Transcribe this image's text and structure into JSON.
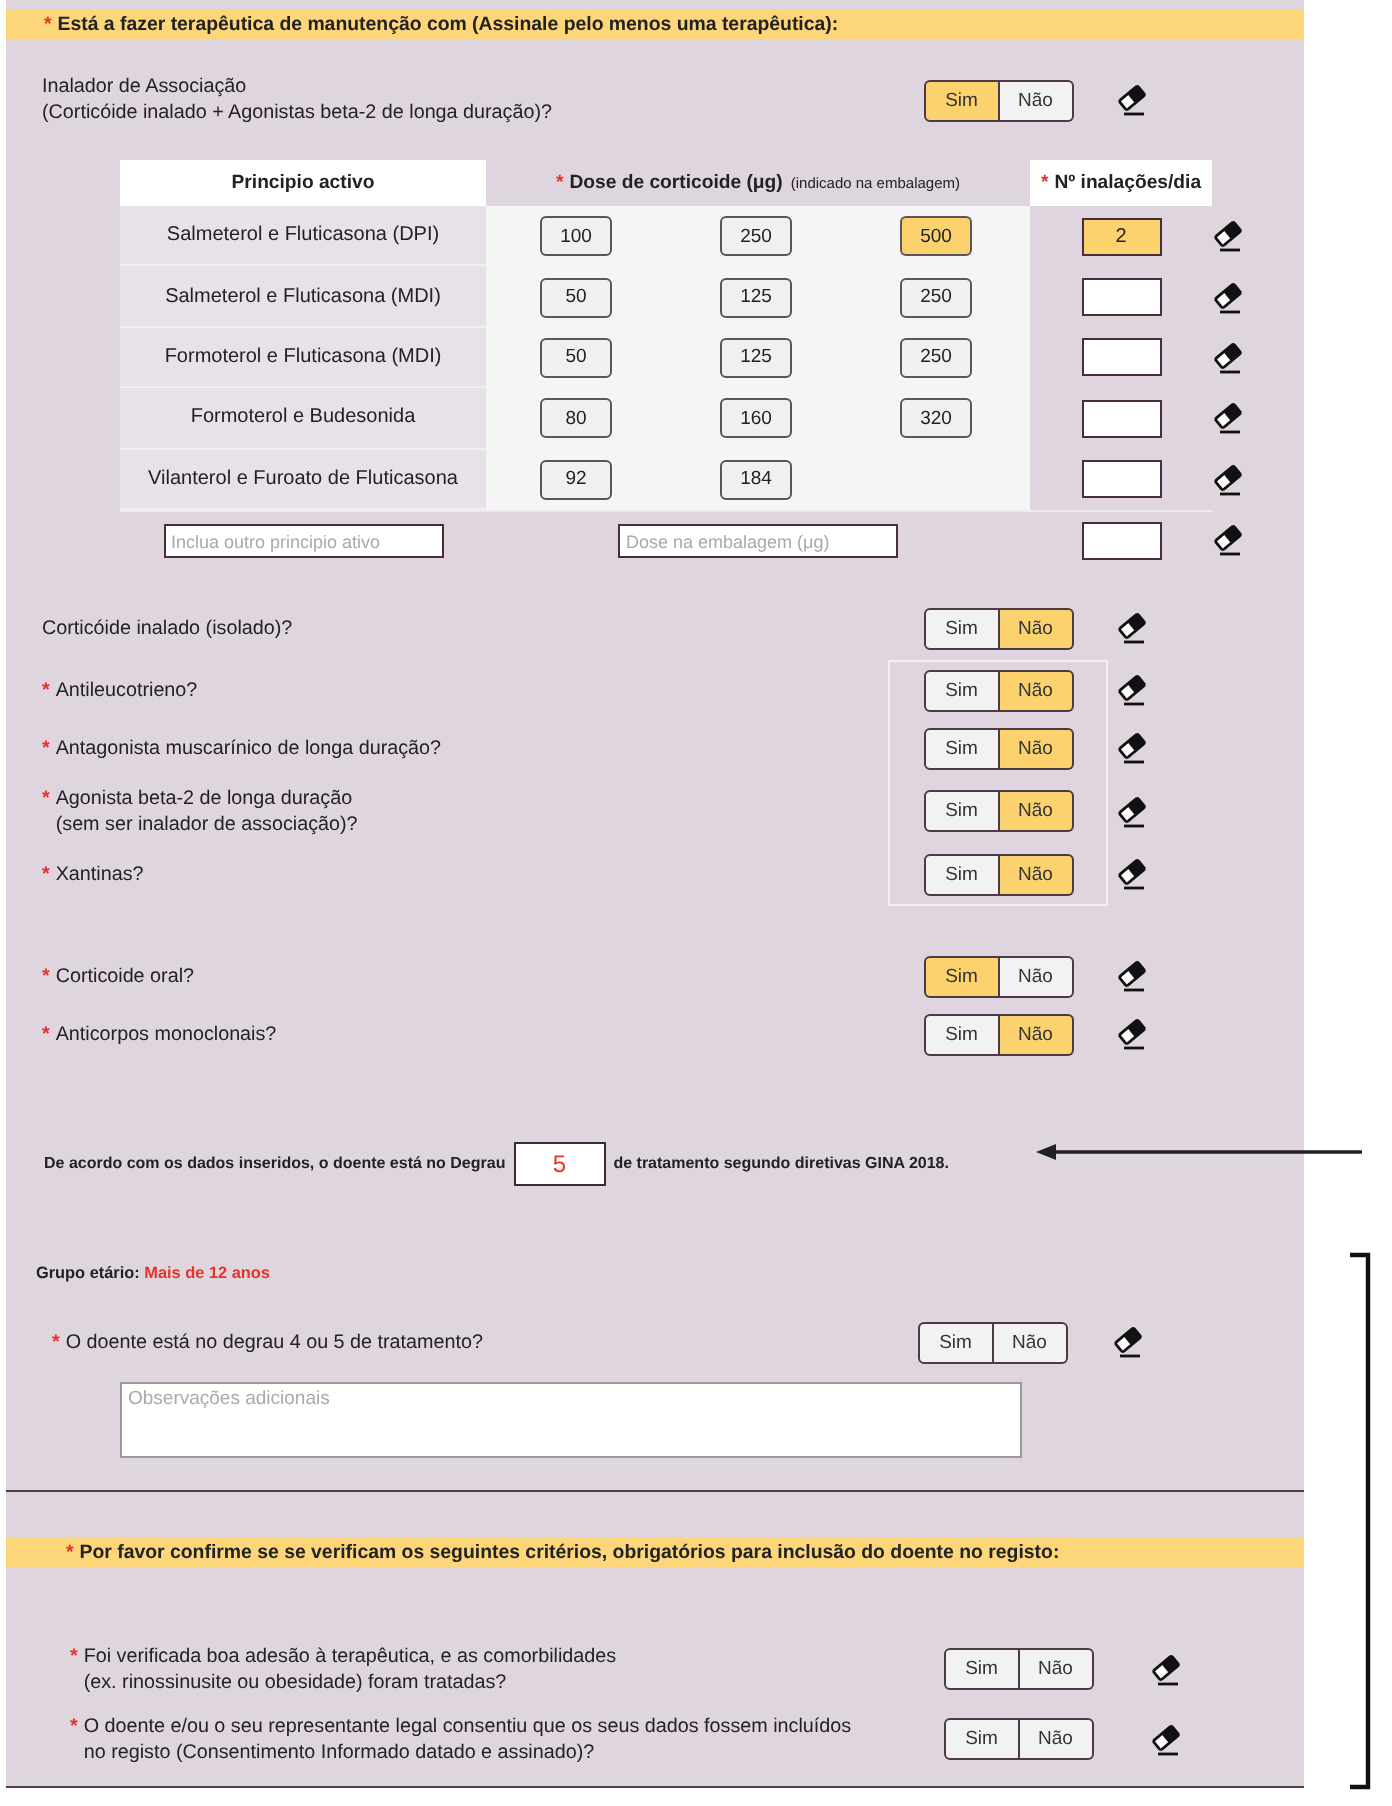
{
  "therapy": {
    "header": {
      "mark": "*",
      "text": "Está a fazer terapêutica de manutenção com (Assinale pelo menos uma terapêutica):"
    },
    "association_inhaler": {
      "label": "Inalador de Associação\n(Corticóide inalado + Agonistas beta-2 de longa duração)?",
      "options": [
        {
          "label": "Sim",
          "selected": true
        },
        {
          "label": "Não",
          "selected": false
        }
      ]
    },
    "table": {
      "columns": [
        {
          "label": "Principio activo"
        },
        {
          "mark": "*",
          "label": "Dose de corticoide (μg)",
          "note": "(indicado na embalagem)"
        },
        {
          "mark": "*",
          "label": "Nº inalações/dia"
        }
      ],
      "rows": [
        {
          "name": "Salmeterol e Fluticasona (DPI)",
          "doses": [
            {
              "label": "100",
              "selected": false
            },
            {
              "label": "250",
              "selected": false
            },
            {
              "label": "500",
              "selected": true
            }
          ],
          "inhalations": {
            "value": "2",
            "highlighted": true
          }
        },
        {
          "name": "Salmeterol e Fluticasona (MDI)",
          "doses": [
            {
              "label": "50",
              "selected": false
            },
            {
              "label": "125",
              "selected": false
            },
            {
              "label": "250",
              "selected": false
            }
          ],
          "inhalations": {
            "highlighted": false
          }
        },
        {
          "name": "Formoterol e Fluticasona (MDI)",
          "doses": [
            {
              "label": "50",
              "selected": false
            },
            {
              "label": "125",
              "selected": false
            },
            {
              "label": "250",
              "selected": false
            }
          ],
          "inhalations": {
            "highlighted": false
          }
        },
        {
          "name": "Formoterol e Budesonida",
          "doses": [
            {
              "label": "80",
              "selected": false
            },
            {
              "label": "160",
              "selected": false
            },
            {
              "label": "320",
              "selected": false
            }
          ],
          "inhalations": {
            "highlighted": false
          }
        },
        {
          "name": "Vilanterol e Furoato de Fluticasona",
          "doses": [
            {
              "label": "92",
              "selected": false
            },
            {
              "label": "184",
              "selected": false
            }
          ],
          "inhalations": {
            "highlighted": false
          }
        }
      ],
      "custom_row": {
        "name_placeholder": "Inclua outro principio ativo",
        "dose_placeholder": "Dose na embalagem (μg)"
      }
    },
    "questions": [
      {
        "label": "Corticóide inalado (isolado)?",
        "options": [
          {
            "label": "Sim",
            "selected": false
          },
          {
            "label": "Não",
            "selected": true
          }
        ]
      }
    ],
    "framed_questions": [
      {
        "mark": "*",
        "label": "Antileucotrieno?",
        "options": [
          {
            "label": "Sim",
            "selected": false
          },
          {
            "label": "Não",
            "selected": true
          }
        ]
      },
      {
        "mark": "*",
        "label": "Antagonista muscarínico de longa duração?",
        "options": [
          {
            "label": "Sim",
            "selected": false
          },
          {
            "label": "Não",
            "selected": true
          }
        ]
      },
      {
        "mark": "*",
        "label": "Agonista beta-2 de longa duração\n(sem ser inalador de associação)?",
        "options": [
          {
            "label": "Sim",
            "selected": false
          },
          {
            "label": "Não",
            "selected": true
          }
        ]
      },
      {
        "mark": "*",
        "label": "Xantinas?",
        "options": [
          {
            "label": "Sim",
            "selected": false
          },
          {
            "label": "Não",
            "selected": true
          }
        ]
      }
    ],
    "more_questions": [
      {
        "mark": "*",
        "label": "Corticoide oral?",
        "options": [
          {
            "label": "Sim",
            "selected": true
          },
          {
            "label": "Não",
            "selected": false
          }
        ]
      },
      {
        "mark": "*",
        "label": "Anticorpos monoclonais?",
        "options": [
          {
            "label": "Sim",
            "selected": false
          },
          {
            "label": "Não",
            "selected": true
          }
        ]
      }
    ]
  },
  "gina_result": {
    "before": "De acordo com os dados inseridos, o doente está no Degrau",
    "step": "5",
    "after": "de tratamento segundo diretivas GINA 2018."
  },
  "age_group": {
    "label": "Grupo etário:",
    "value": "Mais de 12 anos"
  },
  "step_question": {
    "mark": "*",
    "label": "O doente está no degrau 4 ou 5 de tratamento?",
    "options": [
      {
        "label": "Sim",
        "selected": false
      },
      {
        "label": "Não",
        "selected": false
      }
    ],
    "notes_placeholder": "Observações adicionais"
  },
  "criteria": {
    "header": {
      "mark": "*",
      "text": "Por favor confirme se se verificam os seguintes critérios, obrigatórios para inclusão do doente no registo:"
    },
    "questions": [
      {
        "mark": "*",
        "label": "Foi verificada boa adesão à terapêutica, e as comorbilidades\n(ex. rinossinusite ou obesidade) foram tratadas?",
        "options": [
          {
            "label": "Sim",
            "selected": false
          },
          {
            "label": "Não",
            "selected": false
          }
        ]
      },
      {
        "mark": "*",
        "label": "O doente e/ou o seu representante legal consentiu que os seus dados fossem incluídos\nno registo (Consentimento Informado datado e assinado)?",
        "options": [
          {
            "label": "Sim",
            "selected": false
          },
          {
            "label": "Não",
            "selected": false
          }
        ]
      }
    ]
  }
}
